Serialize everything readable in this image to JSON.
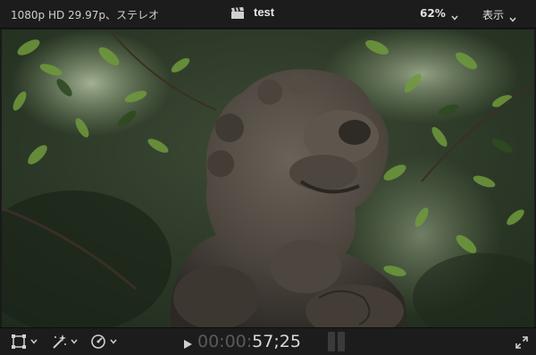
{
  "header": {
    "format_info": "1080p HD 29.97p、ステレオ",
    "title": "test",
    "zoom_label": "62%",
    "view_label": "表示"
  },
  "footer": {
    "timecode_dim": "00:00:",
    "timecode_bright": "57;25"
  },
  "icons": {
    "clapper": "clapperboard-icon",
    "transform": "transform-icon",
    "enhance": "magic-wand-icon",
    "speed": "speedometer-icon",
    "play": "play-icon",
    "fullscreen": "fullscreen-icon"
  },
  "colors": {
    "bar_background": "#1c1c1c",
    "text": "#d8d8d8",
    "timecode_dim": "#5a5a5a"
  }
}
